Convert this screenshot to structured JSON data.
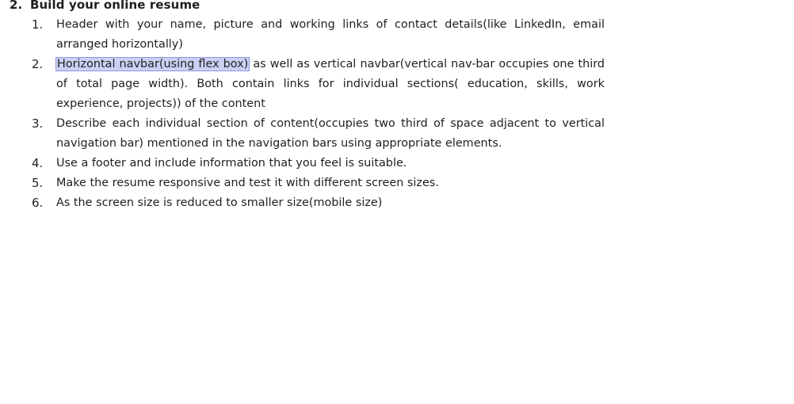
{
  "document": {
    "heading_number": "2.",
    "heading_text": "Build your online resume",
    "items": [
      {
        "number": "1.",
        "text": "Header with your name, picture and working links of contact details(like LinkedIn, email arranged horizontally)"
      },
      {
        "number": "2.",
        "highlight": "Horizontal navbar(using flex box)",
        "text": " as well as vertical navbar(vertical nav-bar occupies one third of total page width). Both contain links for individual sections( education, skills, work experience, projects)) of the content"
      },
      {
        "number": "3.",
        "text": "Describe each individual section of content(occupies two third of space adjacent to vertical navigation bar) mentioned in the navigation bars using appropriate elements."
      },
      {
        "number": "4.",
        "text": "Use a footer and include information that you feel is suitable."
      },
      {
        "number": "5.",
        "text": "Make the resume responsive and test it with different screen sizes."
      },
      {
        "number": "6.",
        "text": "As the screen size is reduced to smaller size(mobile size)"
      }
    ],
    "highlight_color": "#ccd0f5"
  }
}
